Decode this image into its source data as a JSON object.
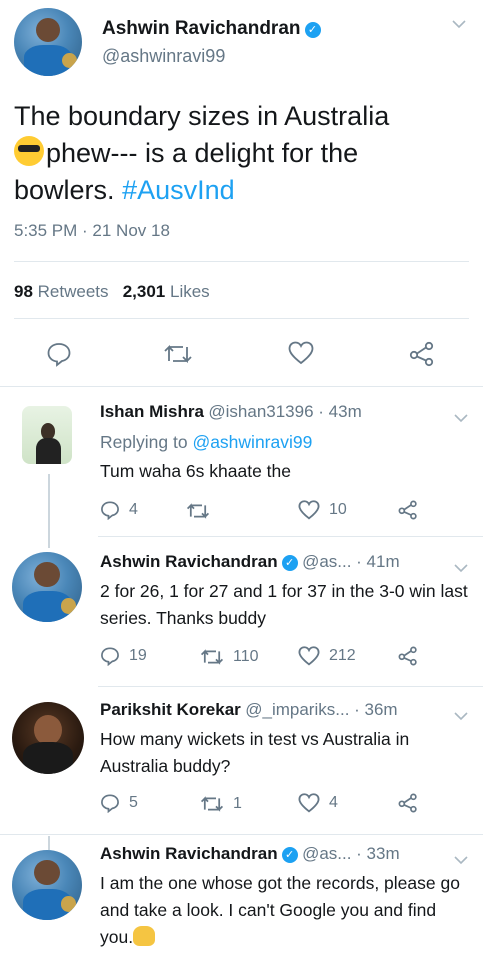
{
  "main_tweet": {
    "author_name": "Ashwin Ravichandran",
    "author_handle": "@ashwinravi99",
    "text_part1": "The boundary sizes in Australia",
    "text_part2": "phew--- is a delight for the",
    "text_part3": "bowlers.",
    "hashtag": "#AusvInd",
    "timestamp": "5:35 PM · 21 Nov 18",
    "retweets_count": "98",
    "retweets_label": "Retweets",
    "likes_count": "2,301",
    "likes_label": "Likes"
  },
  "replies": [
    {
      "author_name": "Ishan Mishra",
      "meta": "@ishan31396 · 43m",
      "replying_label": "Replying to",
      "replying_to": "@ashwinravi99",
      "text": "Tum waha 6s khaate the",
      "reply_count": "4",
      "retweet_count": "",
      "like_count": "10"
    },
    {
      "author_name": "Ashwin Ravichandran",
      "meta": "@as... · 41m",
      "text": "2 for 26, 1 for 27 and 1 for 37 in the 3-0 win last series. Thanks buddy",
      "reply_count": "19",
      "retweet_count": "110",
      "like_count": "212"
    },
    {
      "author_name": "Parikshit Korekar",
      "meta": "@_impariks... · 36m",
      "text": "How many wickets in test vs Australia in Australia buddy?",
      "reply_count": "5",
      "retweet_count": "1",
      "like_count": "4"
    },
    {
      "author_name": "Ashwin Ravichandran",
      "meta": "@as... · 33m",
      "text": "I am the one whose got the records, please go and take a look. I can't Google you and find you."
    }
  ],
  "colors": {
    "accent": "#1da1f2",
    "muted": "#657786",
    "divider": "#e1e8ed"
  },
  "icons": [
    "reply-icon",
    "retweet-icon",
    "like-icon",
    "share-icon",
    "verified-icon",
    "chevron-down-icon"
  ]
}
